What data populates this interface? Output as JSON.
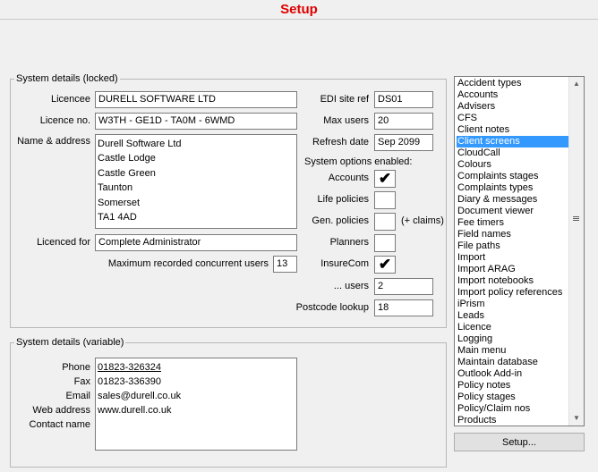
{
  "window": {
    "title": "Setup"
  },
  "locked": {
    "group_title": "System details (locked)",
    "licencee_label": "Licencee",
    "licencee": "DURELL SOFTWARE LTD",
    "licence_no_label": "Licence no.",
    "licence_no": "W3TH - GE1D - TA0M - 6WMD",
    "name_address_label": "Name & address",
    "address_lines": [
      "Durell Software Ltd",
      "Castle Lodge",
      "Castle Green",
      "Taunton",
      "Somerset",
      "TA1 4AD"
    ],
    "licenced_for_label": "Licenced for",
    "licenced_for": "Complete Administrator",
    "max_recorded_label": "Maximum recorded concurrent users",
    "max_recorded": "13",
    "edi_label": "EDI site ref",
    "edi": "DS01",
    "max_users_label": "Max users",
    "max_users": "20",
    "refresh_label": "Refresh date",
    "refresh": "Sep 2099",
    "options_label": "System options enabled:",
    "accounts_label": "Accounts",
    "accounts_checked": true,
    "life_label": "Life policies",
    "life_checked": false,
    "gen_label": "Gen. policies",
    "gen_checked": false,
    "claims_note": "(+ claims)",
    "planners_label": "Planners",
    "planners_checked": false,
    "insurecom_label": "InsureCom",
    "insurecom_checked": true,
    "users_label": "... users",
    "users": "2",
    "postcode_label": "Postcode lookup",
    "postcode": "18",
    "check_glyph": "✔"
  },
  "variable": {
    "group_title": "System details (variable)",
    "phone_label": "Phone",
    "fax_label": "Fax",
    "email_label": "Email",
    "web_label": "Web address",
    "contact_label": "Contact name",
    "lines": [
      "01823-326324",
      "01823-336390",
      "sales@durell.co.uk",
      "www.durell.co.uk",
      ""
    ]
  },
  "setup_list": {
    "items": [
      "Accident types",
      "Accounts",
      "Advisers",
      "CFS",
      "Client notes",
      "Client screens",
      "CloudCall",
      "Colours",
      "Complaints stages",
      "Complaints types",
      "Diary & messages",
      "Document viewer",
      "Fee timers",
      "Field names",
      "File paths",
      "Import",
      "Import ARAG",
      "Import notebooks",
      "Import policy references",
      "iPrism",
      "Leads",
      "Licence",
      "Logging",
      "Main menu",
      "Maintain database",
      "Outlook Add-in",
      "Policy notes",
      "Policy stages",
      "Policy/Claim nos",
      "Products"
    ],
    "selected_index": 5,
    "button_label": "Setup..."
  },
  "icons": {
    "scroll_up": "scroll-up-arrow-icon",
    "scroll_down": "scroll-down-arrow-icon",
    "grip": "scroll-grip-icon"
  }
}
